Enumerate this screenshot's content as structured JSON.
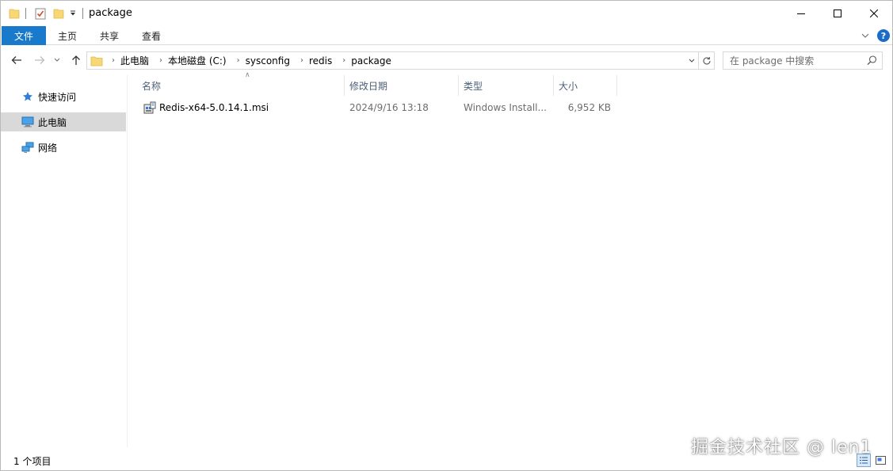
{
  "window": {
    "title": "package",
    "controls": {
      "minimize": "minimize-icon",
      "maximize": "maximize-icon",
      "close": "close-icon"
    }
  },
  "ribbon": {
    "tabs": [
      {
        "label": "文件",
        "active": true
      },
      {
        "label": "主页"
      },
      {
        "label": "共享"
      },
      {
        "label": "查看"
      }
    ]
  },
  "address": {
    "crumbs": [
      "此电脑",
      "本地磁盘 (C:)",
      "sysconfig",
      "redis",
      "package"
    ]
  },
  "search": {
    "placeholder": "在 package 中搜索"
  },
  "nav": {
    "items": [
      {
        "label": "快速访问",
        "icon": "star-icon"
      },
      {
        "label": "此电脑",
        "icon": "computer-icon",
        "selected": true
      },
      {
        "label": "网络",
        "icon": "network-icon"
      }
    ]
  },
  "columns": [
    "名称",
    "修改日期",
    "类型",
    "大小"
  ],
  "files": [
    {
      "name": "Redis-x64-5.0.14.1.msi",
      "modified": "2024/9/16 13:18",
      "type": "Windows Install...",
      "size": "6,952 KB",
      "icon": "msi-installer-icon"
    }
  ],
  "status": {
    "count": "1 个项目"
  },
  "watermark": "掘金技术社区 @ len1",
  "colors": {
    "file_tab": "#1979ca",
    "selected_nav": "#d9d9d9",
    "header_text": "#4c607a"
  }
}
